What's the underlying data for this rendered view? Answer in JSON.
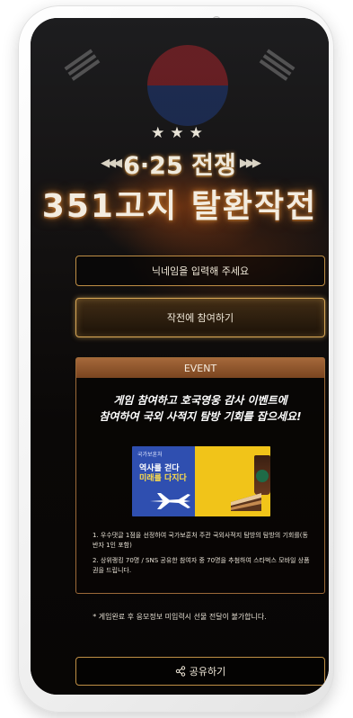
{
  "hero": {
    "stars": "★★★",
    "title_top": "6·25 전쟁",
    "title_main": "351고지 탈환작전"
  },
  "form": {
    "nickname_placeholder": "닉네임을 입력해 주세요",
    "join_label": "작전에 참여하기"
  },
  "event": {
    "header": "EVENT",
    "headline_line1": "게임 참여하고 호국영웅 감사 이벤트에",
    "headline_line2": "참여하여 국외 사적지 탐방 기회를 잡으세요!",
    "banner": {
      "brand": "국가보훈처",
      "line1": "역사를 걷다",
      "line2": "미래를 다지다"
    },
    "note1": "1. 우수댓글 1점을 선정하여 국가보훈처 주관 국외사적지 탐방의 탐방의 기회를(동반자 1인 포함)",
    "note2": "2. 상위랭킹 70명 / SNS 공유한 참여자 중 70명을 추첨하여 스타벅스 모바일 상품권을 드립니다."
  },
  "footnote": "* 게임완료 후 응모정보 미입력시 선물 전달이 불가합니다.",
  "share_label": "공유하기",
  "colors": {
    "accent_border": "#c08f45",
    "event_header": "#a5683a",
    "screen_bg": "#0b0806"
  }
}
